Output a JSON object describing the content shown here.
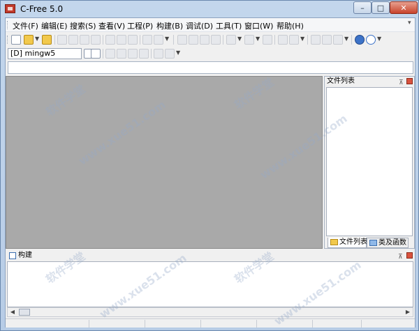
{
  "window": {
    "title": "C-Free 5.0",
    "minimize_glyph": "–",
    "maximize_glyph": "□",
    "close_glyph": "✕"
  },
  "menu": {
    "items": [
      {
        "label": "文件(F)"
      },
      {
        "label": "编辑(E)"
      },
      {
        "label": "搜索(S)"
      },
      {
        "label": "查看(V)"
      },
      {
        "label": "工程(P)"
      },
      {
        "label": "构建(B)"
      },
      {
        "label": "调试(D)"
      },
      {
        "label": "工具(T)"
      },
      {
        "label": "窗口(W)"
      },
      {
        "label": "帮助(H)"
      }
    ]
  },
  "toolbar": {
    "compiler_value": "[D] mingw5"
  },
  "right_panel": {
    "title": "文件列表",
    "pin_glyph": "⊼",
    "tabs": [
      {
        "label": "文件列表",
        "icon": "folder-icon"
      },
      {
        "label": "类及函数",
        "icon": "classes-icon"
      }
    ]
  },
  "bottom_panel": {
    "title": "构建",
    "pin_glyph": "⊼"
  },
  "scroll": {
    "left_glyph": "◀",
    "right_glyph": "▶"
  },
  "watermark": {
    "text1": "软件学堂",
    "text2": "www.xue51.com"
  },
  "colors": {
    "editor_bg": "#a9a9a9",
    "close_button": "#c8442c"
  }
}
